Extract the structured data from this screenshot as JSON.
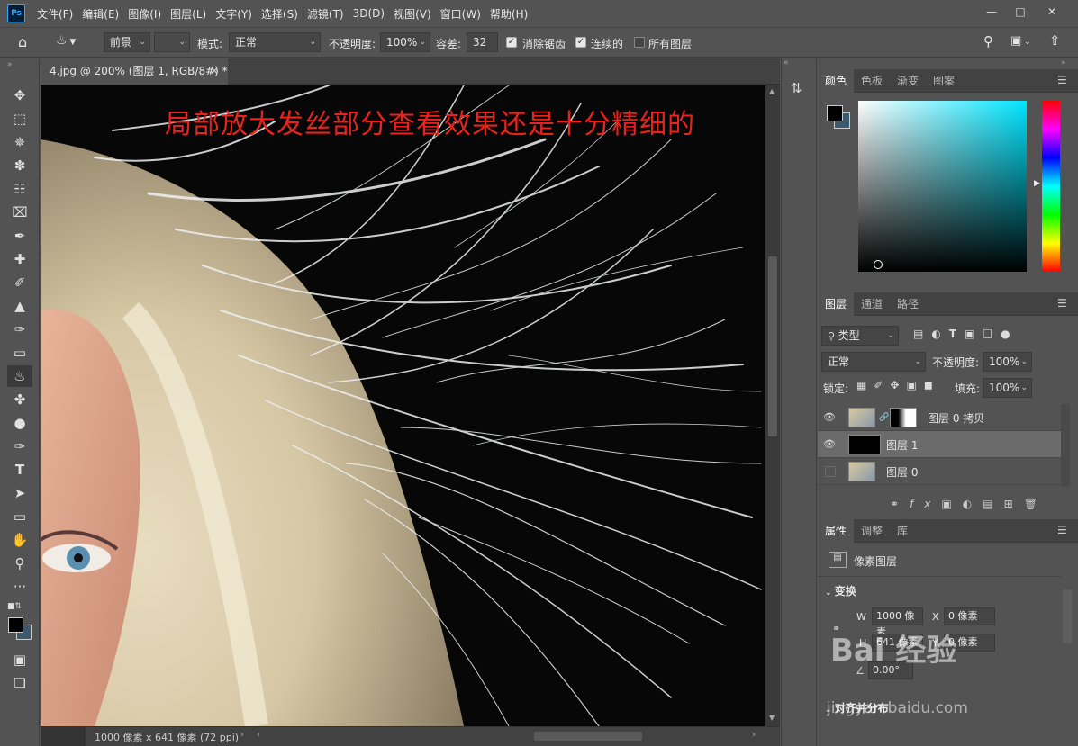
{
  "app": {
    "logo": "Ps"
  },
  "menu": [
    "文件(F)",
    "编辑(E)",
    "图像(I)",
    "图层(L)",
    "文字(Y)",
    "选择(S)",
    "滤镜(T)",
    "3D(D)",
    "视图(V)",
    "窗口(W)",
    "帮助(H)"
  ],
  "options": {
    "fill_source": "前景",
    "mode_label": "模式:",
    "mode_value": "正常",
    "opacity_label": "不透明度:",
    "opacity_value": "100%",
    "tolerance_label": "容差:",
    "tolerance_value": "32",
    "antialias_label": "消除锯齿",
    "contiguous_label": "连续的",
    "all_layers_label": "所有图层"
  },
  "document": {
    "tab_title": "4.jpg @ 200% (图层 1, RGB/8#) *",
    "canvas_caption": "局部放大发丝部分查看效果还是十分精细的",
    "status": "1000 像素 x 641 像素 (72 ppi)"
  },
  "color_panel": {
    "tabs": [
      "颜色",
      "色板",
      "渐变",
      "图案"
    ],
    "hue_color": "#00e5ff"
  },
  "layers_panel": {
    "tabs": [
      "图层",
      "通道",
      "路径"
    ],
    "filter_label": "类型",
    "blend_mode": "正常",
    "opacity_label": "不透明度:",
    "opacity_value": "100%",
    "lock_label": "锁定:",
    "fill_label": "填充:",
    "fill_value": "100%",
    "layers": [
      {
        "name": "图层 0 拷贝",
        "visible": true,
        "selected": false
      },
      {
        "name": "图层 1",
        "visible": true,
        "selected": true
      },
      {
        "name": "图层 0",
        "visible": false,
        "selected": false
      }
    ]
  },
  "properties_panel": {
    "tabs": [
      "属性",
      "调整",
      "库"
    ],
    "type_label": "像素图层",
    "transform_label": "变换",
    "w_label": "W",
    "w_value": "1000 像素",
    "h_label": "H",
    "h_value": "641 像素",
    "x_label": "X",
    "x_value": "0 像素",
    "y_label": "Y",
    "y_value": "0 像素",
    "angle_value": "0.00°",
    "align_label": "对齐并分布"
  },
  "watermark": {
    "brand": "Bai 经验",
    "url": "jingyan.baidu.com"
  }
}
